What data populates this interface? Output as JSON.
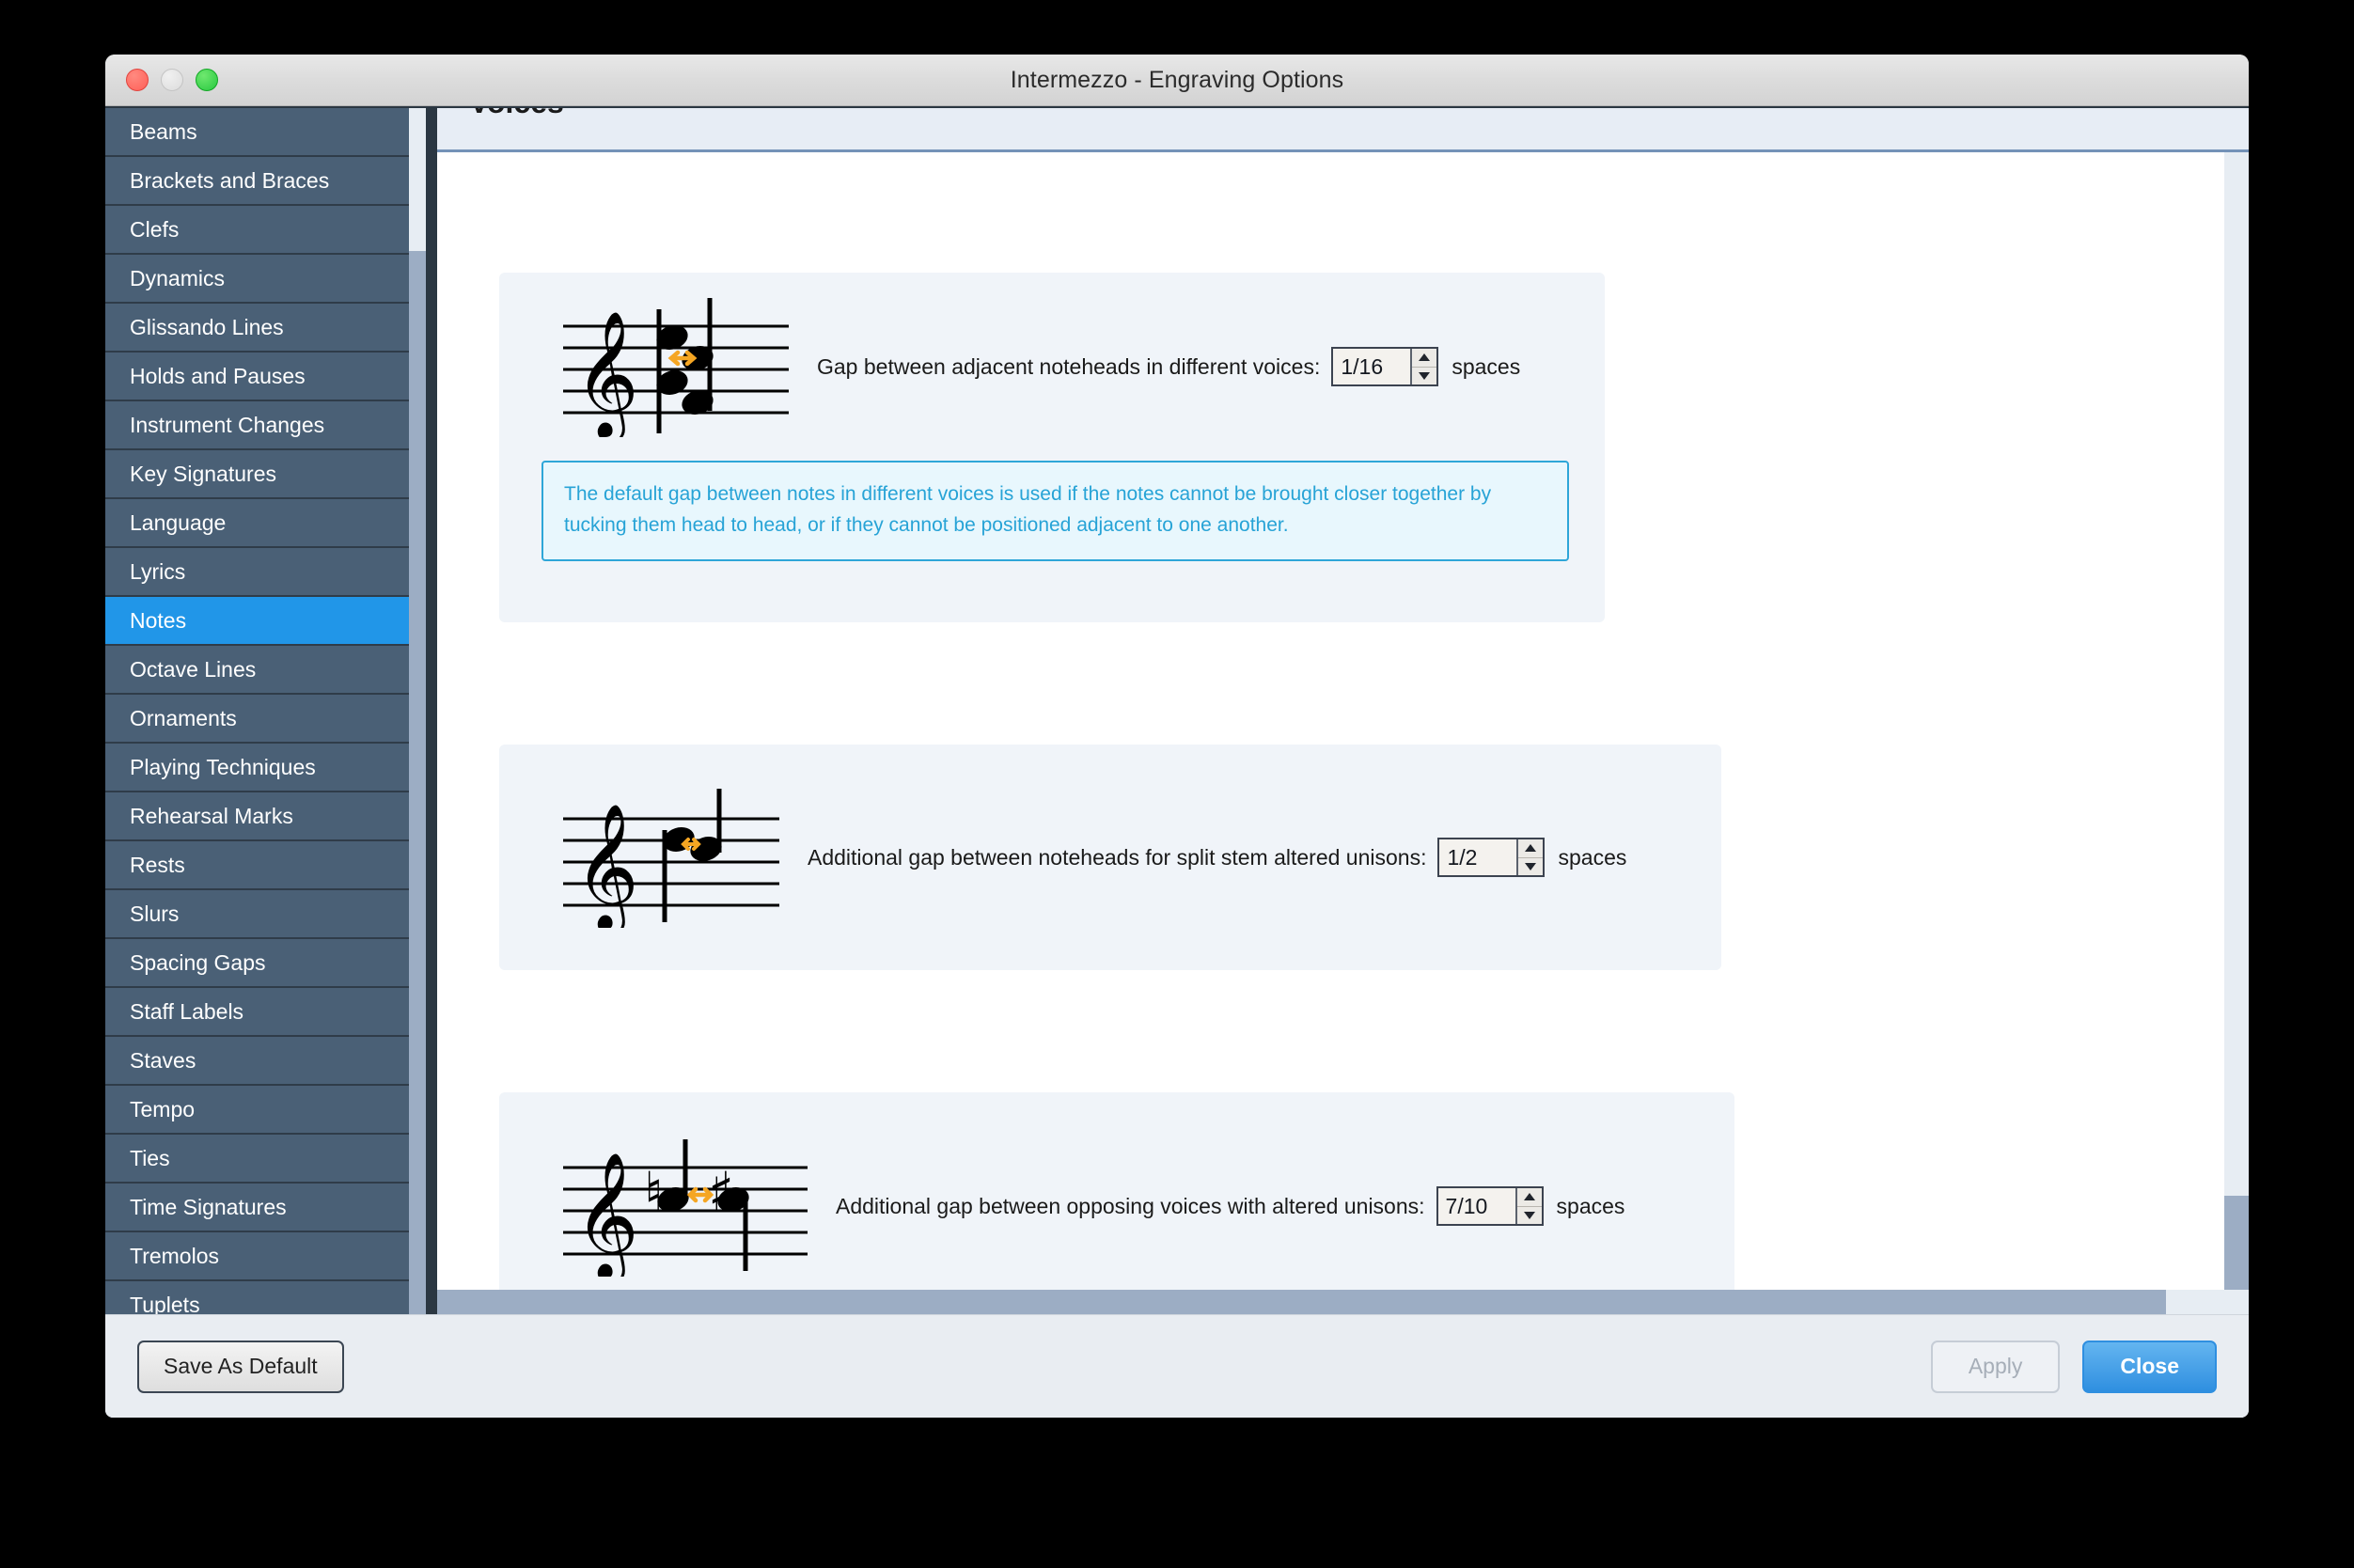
{
  "window": {
    "title": "Intermezzo - Engraving Options",
    "traffic_lights": [
      "close-button",
      "minimize-button",
      "maximize-button"
    ]
  },
  "sidebar": {
    "items": [
      {
        "label": "Beams",
        "selected": false
      },
      {
        "label": "Brackets and Braces",
        "selected": false
      },
      {
        "label": "Clefs",
        "selected": false
      },
      {
        "label": "Dynamics",
        "selected": false
      },
      {
        "label": "Glissando Lines",
        "selected": false
      },
      {
        "label": "Holds and Pauses",
        "selected": false
      },
      {
        "label": "Instrument Changes",
        "selected": false
      },
      {
        "label": "Key Signatures",
        "selected": false
      },
      {
        "label": "Language",
        "selected": false
      },
      {
        "label": "Lyrics",
        "selected": false
      },
      {
        "label": "Notes",
        "selected": true
      },
      {
        "label": "Octave Lines",
        "selected": false
      },
      {
        "label": "Ornaments",
        "selected": false
      },
      {
        "label": "Playing Techniques",
        "selected": false
      },
      {
        "label": "Rehearsal Marks",
        "selected": false
      },
      {
        "label": "Rests",
        "selected": false
      },
      {
        "label": "Slurs",
        "selected": false
      },
      {
        "label": "Spacing Gaps",
        "selected": false
      },
      {
        "label": "Staff Labels",
        "selected": false
      },
      {
        "label": "Staves",
        "selected": false
      },
      {
        "label": "Tempo",
        "selected": false
      },
      {
        "label": "Ties",
        "selected": false
      },
      {
        "label": "Time Signatures",
        "selected": false
      },
      {
        "label": "Tremolos",
        "selected": false
      },
      {
        "label": "Tuplets",
        "selected": false
      }
    ],
    "selected_label": "Notes"
  },
  "content": {
    "section_title": "Voices",
    "options": [
      {
        "label": "Gap between adjacent noteheads in different voices:",
        "value": "1/16",
        "units": "spaces",
        "figure": "notation-four-noteheads-two-voices"
      },
      {
        "label": "Additional gap between noteheads for split stem altered unisons:",
        "value": "1/2",
        "units": "spaces",
        "figure": "notation-split-stem-altered-unison"
      },
      {
        "label": "Additional gap between opposing voices with altered unisons:",
        "value": "7/10",
        "units": "spaces",
        "figure": "notation-opposing-voices-altered-unisons"
      }
    ],
    "tip": "The default gap between notes in different voices is used if the notes cannot be brought closer together by tucking them head to head, or if they cannot be positioned adjacent to one another.",
    "spinner_up_icon": "chevron-up-icon",
    "spinner_down_icon": "chevron-down-icon"
  },
  "footer": {
    "save_as_default_label": "Save As Default",
    "apply_label": "Apply",
    "apply_enabled": false,
    "close_label": "Close"
  },
  "colors": {
    "accent_blue": "#2196e8",
    "sidebar_bg": "#4a6076",
    "panel_bg": "#f0f4f9",
    "tip_border": "#2ea6d8",
    "tip_text": "#27a3d6",
    "tip_bg": "#e8f7fd",
    "arrow_orange": "#f5a623",
    "scrollbar_thumb": "#9cadc4"
  }
}
